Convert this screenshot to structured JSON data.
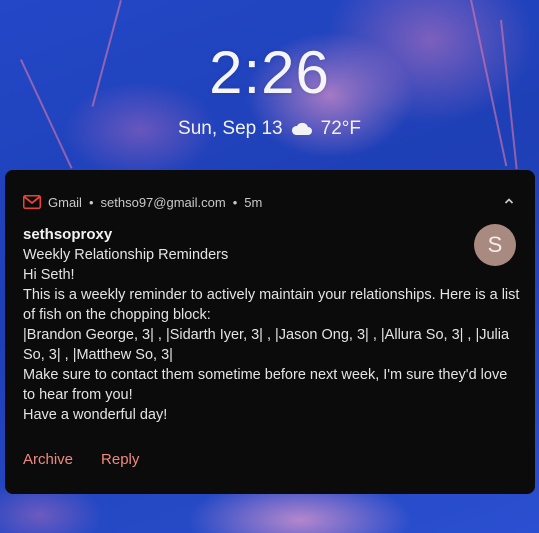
{
  "lockscreen": {
    "time": "2:26",
    "date": "Sun, Sep 13",
    "temperature": "72°F",
    "weather_icon": "cloud-icon"
  },
  "notification": {
    "app_name": "Gmail",
    "separator": "•",
    "account": "sethso97@gmail.com",
    "age": "5m",
    "sender": "sethsoproxy",
    "avatar_letter": "S",
    "colors": {
      "accent": "#f08a7e",
      "avatar_bg": "#a98a80",
      "card_bg": "#0b0b0b",
      "gmail_red": "#ea4335"
    },
    "lines": [
      "Weekly Relationship Reminders",
      "Hi Seth!",
      "This is a weekly reminder to actively maintain your relationships. Here is a list",
      "of fish on the chopping block:",
      "|Brandon George, 3| ,  |Sidarth Iyer, 3| ,  |Jason Ong, 3| ,  |Allura So, 3| ,  |Julia",
      "So, 3| ,  |Matthew So, 3|",
      "Make sure to contact them sometime before next week, I'm sure they'd love",
      "to hear from you!",
      "Have a wonderful day!"
    ],
    "actions": {
      "archive": "Archive",
      "reply": "Reply"
    }
  }
}
